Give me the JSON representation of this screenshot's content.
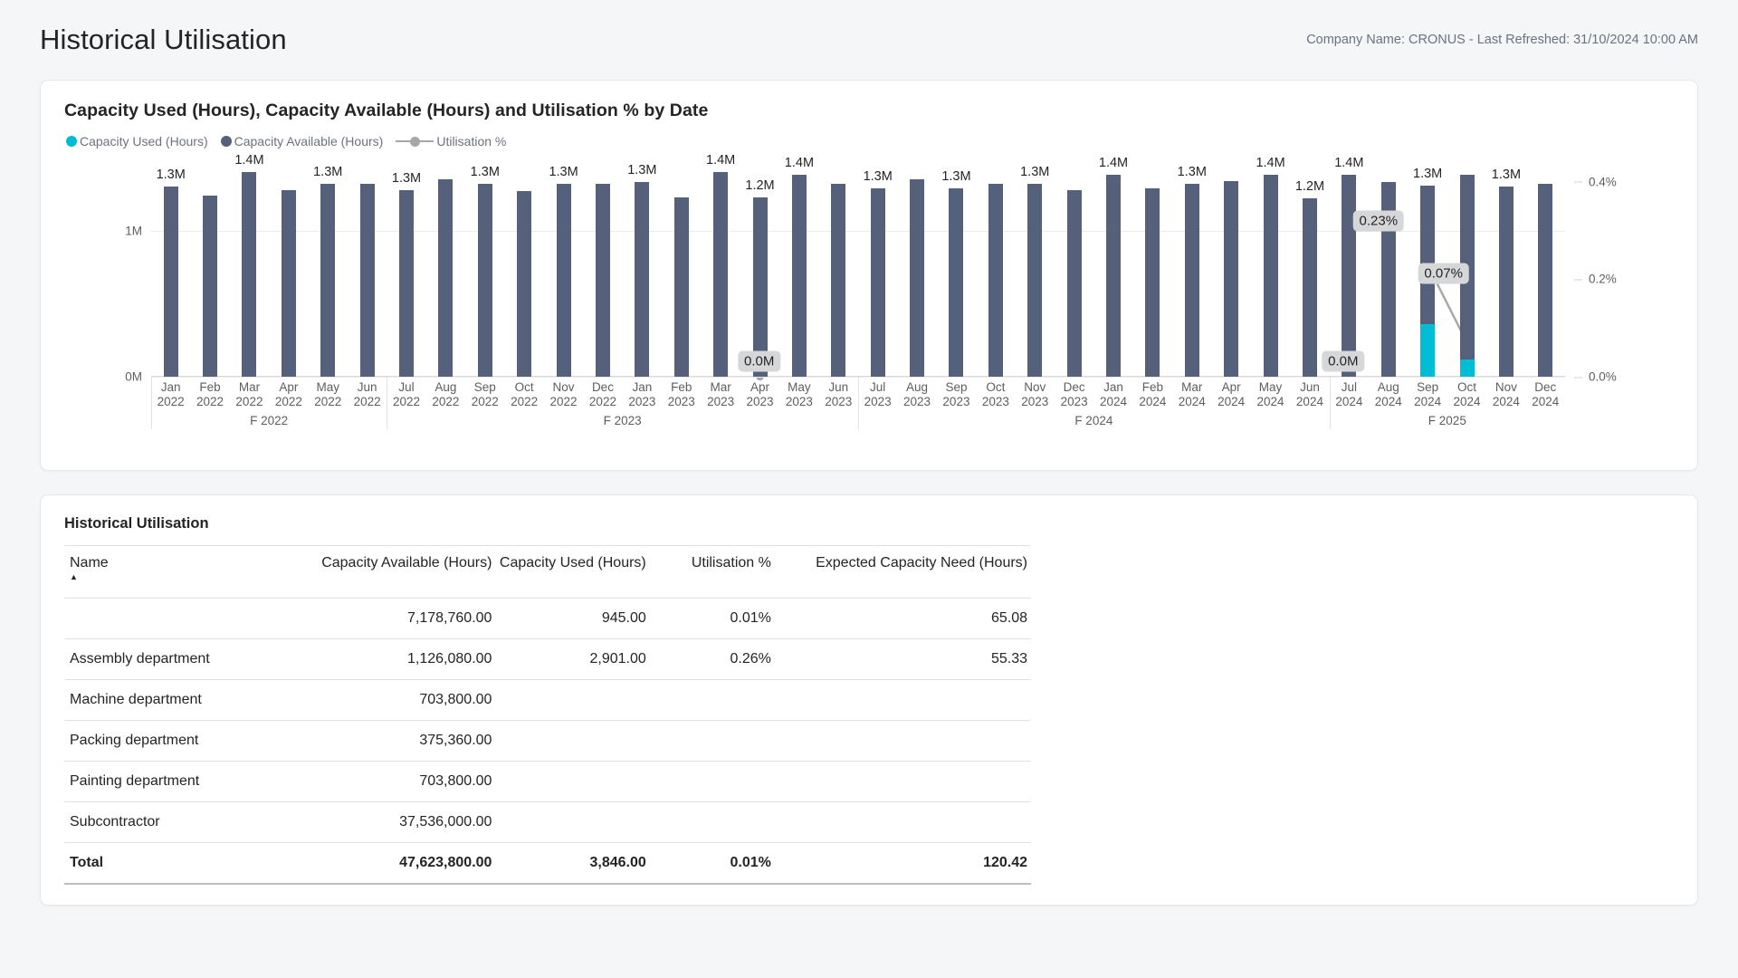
{
  "header": {
    "title": "Historical Utilisation",
    "refresh_info": "Company Name: CRONUS - Last Refreshed: 31/10/2024 10:00 AM"
  },
  "chart_card": {
    "title": "Capacity Used (Hours), Capacity Available (Hours) and Utilisation % by Date",
    "legend": [
      {
        "label": "Capacity Used (Hours)",
        "marker": "dot",
        "color": "#00bcd4"
      },
      {
        "label": "Capacity Available (Hours)",
        "marker": "dot",
        "color": "#55617a"
      },
      {
        "label": "Utilisation %",
        "marker": "line",
        "color": "#a6a6a6"
      }
    ]
  },
  "chart_data": {
    "type": "bar",
    "title": "Capacity Used (Hours), Capacity Available (Hours) and Utilisation % by Date",
    "xlabel": "",
    "ylabel": "",
    "grid": true,
    "legend_position": "top-left",
    "y_left": {
      "ticks": [
        "0M",
        "1M"
      ],
      "values": [
        0,
        1000000
      ],
      "lim": [
        0,
        1500000
      ]
    },
    "y_right": {
      "ticks": [
        "0.0%",
        "0.2%",
        "0.4%"
      ],
      "values": [
        0,
        0.2,
        0.4
      ],
      "lim": [
        0,
        0.45
      ]
    },
    "categories": [
      "Jan 2022",
      "Feb 2022",
      "Mar 2022",
      "Apr 2022",
      "May 2022",
      "Jun 2022",
      "Jul 2022",
      "Aug 2022",
      "Sep 2022",
      "Oct 2022",
      "Nov 2022",
      "Dec 2022",
      "Jan 2023",
      "Feb 2023",
      "Mar 2023",
      "Apr 2023",
      "May 2023",
      "Jun 2023",
      "Jul 2023",
      "Aug 2023",
      "Sep 2023",
      "Oct 2023",
      "Nov 2023",
      "Dec 2023",
      "Jan 2024",
      "Feb 2024",
      "Mar 2024",
      "Apr 2024",
      "May 2024",
      "Jun 2024",
      "Jul 2024",
      "Aug 2024",
      "Sep 2024",
      "Oct 2024",
      "Nov 2024",
      "Dec 2024"
    ],
    "month_labels": [
      "Jan",
      "Feb",
      "Mar",
      "Apr",
      "May",
      "Jun",
      "Jul",
      "Aug",
      "Sep",
      "Oct",
      "Nov",
      "Dec",
      "Jan",
      "Feb",
      "Mar",
      "Apr",
      "May",
      "Jun",
      "Jul",
      "Aug",
      "Sep",
      "Oct",
      "Nov",
      "Dec",
      "Jan",
      "Feb",
      "Mar",
      "Apr",
      "May",
      "Jun",
      "Jul",
      "Aug",
      "Sep",
      "Oct",
      "Nov",
      "Dec"
    ],
    "year_labels": [
      "2022",
      "2022",
      "2022",
      "2022",
      "2022",
      "2022",
      "2022",
      "2022",
      "2022",
      "2022",
      "2022",
      "2022",
      "2023",
      "2023",
      "2023",
      "2023",
      "2023",
      "2023",
      "2023",
      "2023",
      "2023",
      "2023",
      "2023",
      "2023",
      "2024",
      "2024",
      "2024",
      "2024",
      "2024",
      "2024",
      "2024",
      "2024",
      "2024",
      "2024",
      "2024",
      "2024"
    ],
    "fiscal_groups": [
      {
        "label": "F 2022",
        "start": 0,
        "end": 5
      },
      {
        "label": "F 2023",
        "start": 6,
        "end": 17
      },
      {
        "label": "F 2024",
        "start": 18,
        "end": 29
      },
      {
        "label": "F 2025",
        "start": 30,
        "end": 35
      }
    ],
    "series": [
      {
        "name": "Capacity Available (Hours)",
        "color": "#55617a",
        "values": [
          1300000,
          1240000,
          1400000,
          1280000,
          1320000,
          1320000,
          1280000,
          1350000,
          1320000,
          1270000,
          1320000,
          1320000,
          1330000,
          1230000,
          1400000,
          1230000,
          1380000,
          1320000,
          1290000,
          1350000,
          1290000,
          1320000,
          1320000,
          1280000,
          1380000,
          1290000,
          1320000,
          1340000,
          1380000,
          1220000,
          1380000,
          1330000,
          1310000,
          1380000,
          1300000,
          1320000
        ],
        "labels": [
          "1.3M",
          "",
          "1.4M",
          "",
          "1.3M",
          "",
          "1.3M",
          "",
          "1.3M",
          "",
          "1.3M",
          "",
          "1.3M",
          "",
          "1.4M",
          "1.2M",
          "1.4M",
          "",
          "1.3M",
          "",
          "1.3M",
          "",
          "1.3M",
          "",
          "1.4M",
          "",
          "1.3M",
          "",
          "1.4M",
          "1.2M",
          "1.4M",
          "",
          "1.3M",
          "",
          "1.3M",
          ""
        ]
      },
      {
        "name": "Capacity Used (Hours)",
        "color": "#00bcd4",
        "values": [
          0,
          0,
          0,
          0,
          0,
          0,
          0,
          0,
          0,
          0,
          0,
          0,
          0,
          0,
          0,
          0,
          0,
          0,
          0,
          0,
          0,
          0,
          0,
          0,
          0,
          0,
          0,
          0,
          0,
          0,
          0,
          0,
          3000,
          1000,
          0,
          0
        ]
      },
      {
        "name": "Utilisation %",
        "color": "#a6a6a6",
        "axis": "right",
        "values": [
          null,
          null,
          null,
          null,
          null,
          null,
          null,
          null,
          null,
          null,
          null,
          null,
          null,
          null,
          null,
          0.0,
          null,
          null,
          null,
          null,
          null,
          null,
          null,
          null,
          null,
          null,
          null,
          null,
          null,
          null,
          null,
          null,
          0.23,
          0.07,
          null,
          null
        ]
      }
    ],
    "callouts": [
      {
        "text": "0.0M",
        "category": "Apr 2023",
        "kind": "data-label"
      },
      {
        "text": "0.23%",
        "category": "Sep 2024",
        "kind": "data-label"
      },
      {
        "text": "0.07%",
        "category": "Oct 2024",
        "kind": "data-label"
      },
      {
        "text": "0.0M",
        "category": "Aug 2024",
        "kind": "data-label"
      }
    ]
  },
  "table": {
    "title": "Historical Utilisation",
    "sort_column": "Name",
    "sort_direction": "asc",
    "columns": [
      "Name",
      "Capacity Available (Hours)",
      "Capacity Used (Hours)",
      "Utilisation %",
      "Expected Capacity Need (Hours)"
    ],
    "rows": [
      {
        "name": "",
        "available": "7,178,760.00",
        "used": "945.00",
        "utilisation": "0.01%",
        "expected": "65.08"
      },
      {
        "name": "Assembly department",
        "available": "1,126,080.00",
        "used": "2,901.00",
        "utilisation": "0.26%",
        "expected": "55.33"
      },
      {
        "name": "Machine department",
        "available": "703,800.00",
        "used": "",
        "utilisation": "",
        "expected": ""
      },
      {
        "name": "Packing department",
        "available": "375,360.00",
        "used": "",
        "utilisation": "",
        "expected": ""
      },
      {
        "name": "Painting department",
        "available": "703,800.00",
        "used": "",
        "utilisation": "",
        "expected": ""
      },
      {
        "name": "Subcontractor",
        "available": "37,536,000.00",
        "used": "",
        "utilisation": "",
        "expected": ""
      },
      {
        "name": "Total",
        "available": "47,623,800.00",
        "used": "3,846.00",
        "utilisation": "0.01%",
        "expected": "120.42"
      }
    ]
  }
}
